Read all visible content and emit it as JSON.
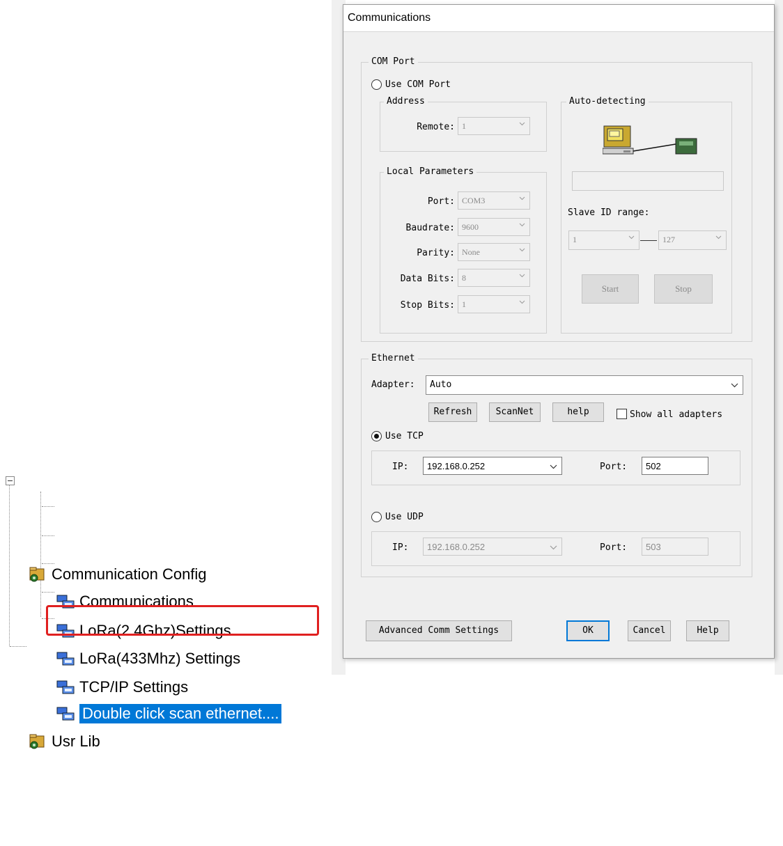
{
  "tree": {
    "root_label": "Communication Config",
    "items": [
      {
        "label": "Communications"
      },
      {
        "label": "LoRa(2.4Ghz)Settings"
      },
      {
        "label": "LoRa(433Mhz) Settings"
      },
      {
        "label": "TCP/IP Settings"
      },
      {
        "label": "Double click scan ethernet...."
      }
    ],
    "usr_lib_label": "Usr Lib"
  },
  "dialog": {
    "title": "Communications",
    "com_port": {
      "group_label": "COM Port",
      "use_label": "Use COM Port",
      "address_group": "Address",
      "remote_label": "Remote:",
      "remote_value": "1",
      "local_group": "Local Parameters",
      "port_label": "Port:",
      "port_value": "COM3",
      "baudrate_label": "Baudrate:",
      "baudrate_value": "9600",
      "parity_label": "Parity:",
      "parity_value": "None",
      "databits_label": "Data Bits:",
      "databits_value": "8",
      "stopbits_label": "Stop Bits:",
      "stopbits_value": "1"
    },
    "auto_detect": {
      "group_label": "Auto-detecting",
      "slave_label": "Slave ID range:",
      "from_value": "1",
      "to_value": "127",
      "start_label": "Start",
      "stop_label": "Stop"
    },
    "ethernet": {
      "group_label": "Ethernet",
      "adapter_label": "Adapter:",
      "adapter_value": "Auto",
      "refresh_label": "Refresh",
      "scannet_label": "ScanNet",
      "help_label": "help",
      "show_all_label": "Show all adapters",
      "use_tcp_label": "Use TCP",
      "tcp_ip_label": "IP:",
      "tcp_ip_value": "192.168.0.252",
      "tcp_port_label": "Port:",
      "tcp_port_value": "502",
      "use_udp_label": "Use UDP",
      "udp_ip_label": "IP:",
      "udp_ip_value": "192.168.0.252",
      "udp_port_label": "Port:",
      "udp_port_value": "503"
    },
    "footer": {
      "advanced_label": "Advanced Comm Settings",
      "ok_label": "OK",
      "cancel_label": "Cancel",
      "help_label": "Help"
    }
  }
}
